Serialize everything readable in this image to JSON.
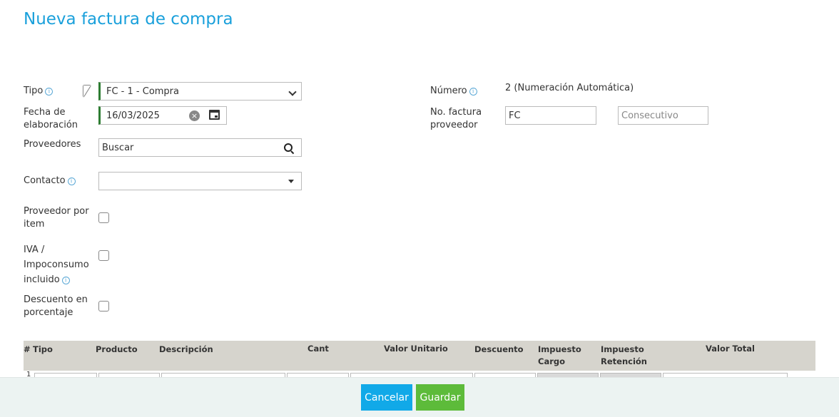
{
  "page": {
    "title": "Nueva factura de compra"
  },
  "form": {
    "tipo": {
      "label": "Tipo",
      "value": "FC - 1 - Compra"
    },
    "fecha": {
      "label_line1": "Fecha de",
      "label_line2": "elaboración",
      "value": "16/03/2025"
    },
    "proveedores": {
      "label": "Proveedores",
      "value": "Buscar"
    },
    "contacto": {
      "label": "Contacto",
      "value": ""
    },
    "proveedor_por_item": {
      "label_line1": "Proveedor por",
      "label_line2": "item"
    },
    "iva": {
      "label_line1": "IVA /",
      "label_line2": "Impoconsumo",
      "label_line3": "incluido"
    },
    "descuento": {
      "label_line1": "Descuento en",
      "label_line2": "porcentaje"
    },
    "numero": {
      "label": "Número",
      "value": "2 (Numeración Automática)"
    },
    "no_factura": {
      "label_line1": "No. factura",
      "label_line2": "proveedor",
      "prefix_value": "FC",
      "consecutivo_placeholder": "Consecutivo"
    }
  },
  "table": {
    "headers": {
      "num": "#",
      "tipo": "Tipo",
      "producto": "Producto",
      "descripcion": "Descripción",
      "cant": "Cant",
      "valor_unitario": "Valor Unitario",
      "descuento": "Descuento",
      "impuesto_cargo_1": "Impuesto",
      "impuesto_cargo_2": "Cargo",
      "impuesto_retencion_1": "Impuesto",
      "impuesto_retencion_2": "Retención",
      "valor_total": "Valor Total"
    },
    "first_row_number": "1"
  },
  "footer": {
    "cancel_label": "Cancelar",
    "save_label": "Guardar"
  },
  "colors": {
    "title": "#1aa0db",
    "required_border": "#2e7d32",
    "cancel_button": "#11a9e8",
    "save_button": "#5dbb3a",
    "table_header": "#d6d4cd",
    "footer": "#ecf3f2"
  }
}
